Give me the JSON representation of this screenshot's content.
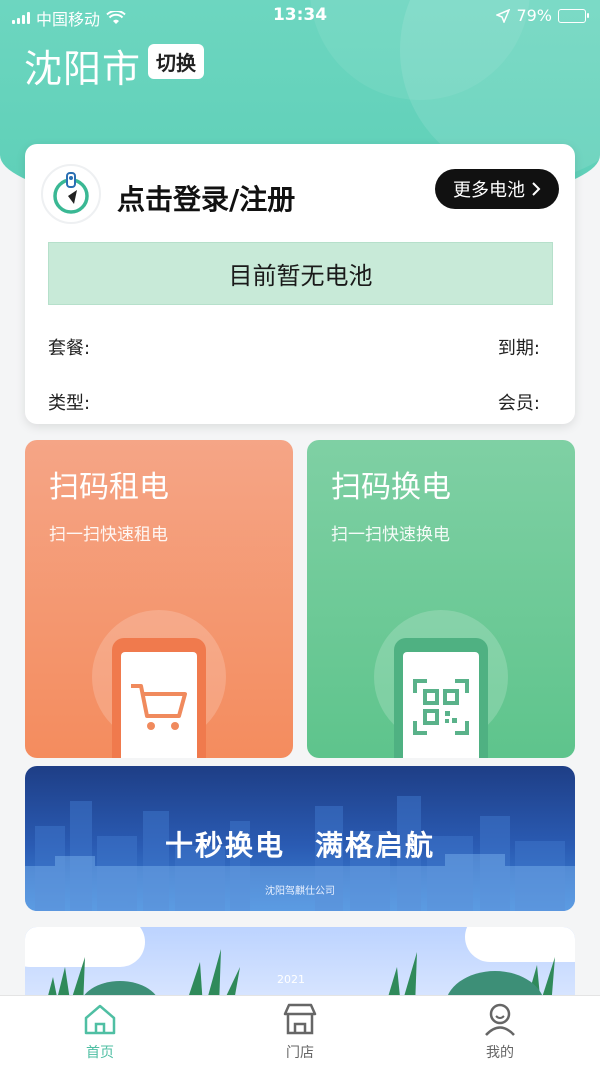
{
  "status_bar": {
    "carrier": "中国移动",
    "time": "13:34",
    "battery": "79%",
    "icons": [
      "signal-icon",
      "wifi-icon",
      "location-arrow-icon",
      "battery-charging-icon"
    ]
  },
  "header": {
    "city": "沈阳市",
    "switch_label": "切换"
  },
  "user_card": {
    "login_label": "点击登录/注册",
    "more_battery_label": "更多电池",
    "no_battery_text": "目前暂无电池",
    "package_label": "套餐:",
    "expire_label": "到期:",
    "type_label": "类型:",
    "member_label": "会员:"
  },
  "actions": {
    "rent": {
      "title": "扫码租电",
      "subtitle": "扫一扫快速租电",
      "icon": "shopping-cart-icon",
      "color": "#f48c5e"
    },
    "swap": {
      "title": "扫码换电",
      "subtitle": "扫一扫快速换电",
      "icon": "qr-code-icon",
      "color": "#5ec48c"
    }
  },
  "banner": {
    "slogan": "十秒换电　满格启航",
    "company": "沈阳驾麒仕公司"
  },
  "banner2": {
    "year_text": "2021"
  },
  "tabbar": {
    "home": "首页",
    "store": "门店",
    "mine": "我的",
    "active_color": "#4fbfa3"
  }
}
